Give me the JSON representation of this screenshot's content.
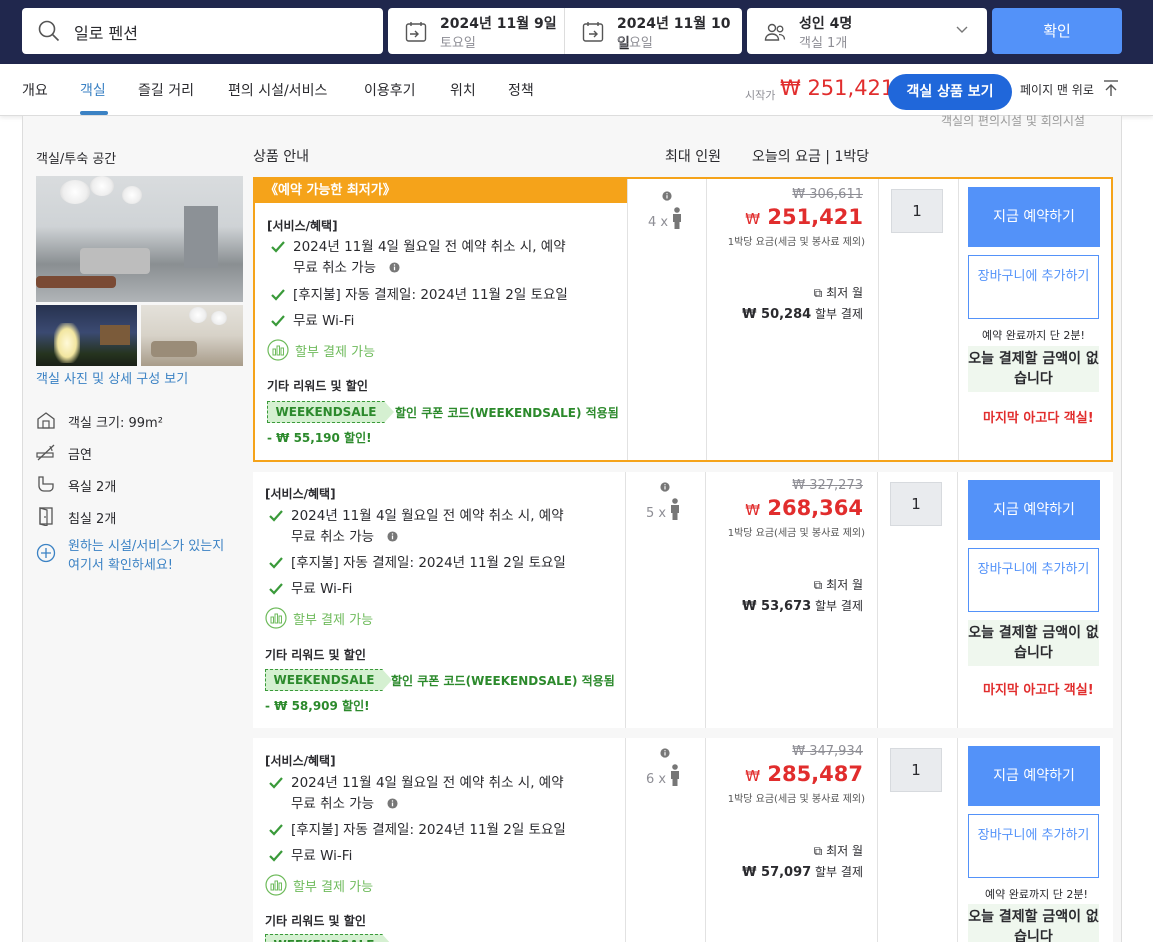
{
  "search": {
    "destination": "일로 펜션",
    "checkin_date": "2024년 11월 9일",
    "checkin_day": "토요일",
    "checkout_date": "2024년 11월 10일",
    "checkout_day": "일요일",
    "guests": "성인 4명",
    "rooms": "객실 1개",
    "confirm_label": "확인"
  },
  "nav": {
    "tabs": [
      "개요",
      "객실",
      "즐길 거리",
      "편의 시설/서비스",
      "이용후기",
      "위치",
      "정책"
    ],
    "active_tab": "객실",
    "from_label": "시작가",
    "from_price": "₩ 251,421",
    "view_rooms_label": "객실 상품 보기",
    "to_top_label": "페이지 맨 위로"
  },
  "partial_text": "객실의 편의시설 및 회의시설",
  "room": {
    "section_title": "객실/투숙 공간",
    "photo_link": "객실 사진 및 상세 구성 보기",
    "features": [
      {
        "icon": "house-icon",
        "label": "객실 크기: 99m²"
      },
      {
        "icon": "no-smoking-icon",
        "label": "금연"
      },
      {
        "icon": "bathtub-icon",
        "label": "욕실 2개"
      },
      {
        "icon": "bedroom-door-icon",
        "label": "침실 2개"
      }
    ],
    "more_link": "원하는 시설/서비스가 있는지 여기서 확인하세요!"
  },
  "columns": {
    "product": "상품 안내",
    "max_guests": "최대 인원",
    "price": "오늘의 요금 | 1박당"
  },
  "best_label": "《예약 가능한 최저가》",
  "common": {
    "services_heading": "[서비스/혜택]",
    "benefit_cancel_1": "2024년 11월 4일 월요일 전 예약 취소 시, 예약",
    "benefit_cancel_2": "무료 취소 가능",
    "benefit_pay": "[후지불] 자동 결제일: 2024년 11월 2일 토요일",
    "benefit_wifi": "무료 Wi-Fi",
    "installment": "할부 결제 가능",
    "promo_heading": "기타 리워드 및 할인",
    "coupon_code": "WEEKENDSALE",
    "coupon_text": "할인 쿠폰 코드(WEEKENDSALE) 적용됨",
    "price_note": "1박당 요금(세금 및 봉사료 제외)",
    "lowest_monthly": "최저 월",
    "installment_suffix": "할부 결제",
    "book_label": "지금 예약하기",
    "cart_label": "장바구니에 추가하기",
    "two_min": "예약 완료까지 단 2분!",
    "pay_today": "오늘 결제할 금액이 없습니다",
    "last_room": "마지막 아고다 객실!"
  },
  "offers": [
    {
      "guests": "4 x",
      "old_price": "₩ 306,611",
      "new_price_currency": "₩",
      "new_price": "251,421",
      "monthly": "₩ 50,284",
      "discount": "- ₩ 55,190 할인!",
      "qty": "1"
    },
    {
      "guests": "5 x",
      "old_price": "₩ 327,273",
      "new_price_currency": "₩",
      "new_price": "268,364",
      "monthly": "₩ 53,673",
      "discount": "- ₩ 58,909 할인!",
      "qty": "1"
    },
    {
      "guests": "6 x",
      "old_price": "₩ 347,934",
      "new_price_currency": "₩",
      "new_price": "285,487",
      "monthly": "₩ 57,097",
      "discount": "",
      "qty": "1"
    }
  ],
  "colors": {
    "topbar": "#20274d",
    "primary": "#5392f9",
    "price_red": "#e12d2d",
    "best_orange": "#f5a31a",
    "green": "#2c8a2c"
  }
}
